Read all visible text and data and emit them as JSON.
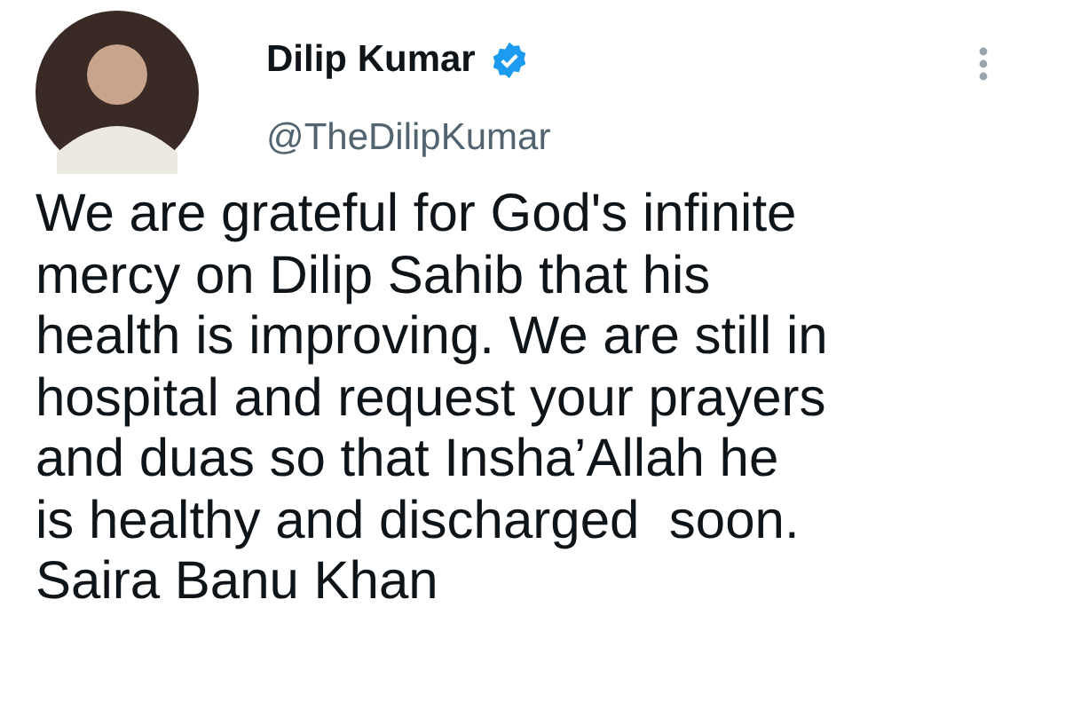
{
  "author": {
    "name": "Dilip Kumar",
    "verified": true,
    "handle": "@TheDilipKumar"
  },
  "tweet": {
    "text": "We are grateful for God's infinite\nmercy on Dilip Sahib that his\nhealth is improving. We are still in\nhospital and request your prayers\nand duas so that Insha’Allah he\nis healthy and discharged  soon.\nSaira Banu Khan"
  }
}
